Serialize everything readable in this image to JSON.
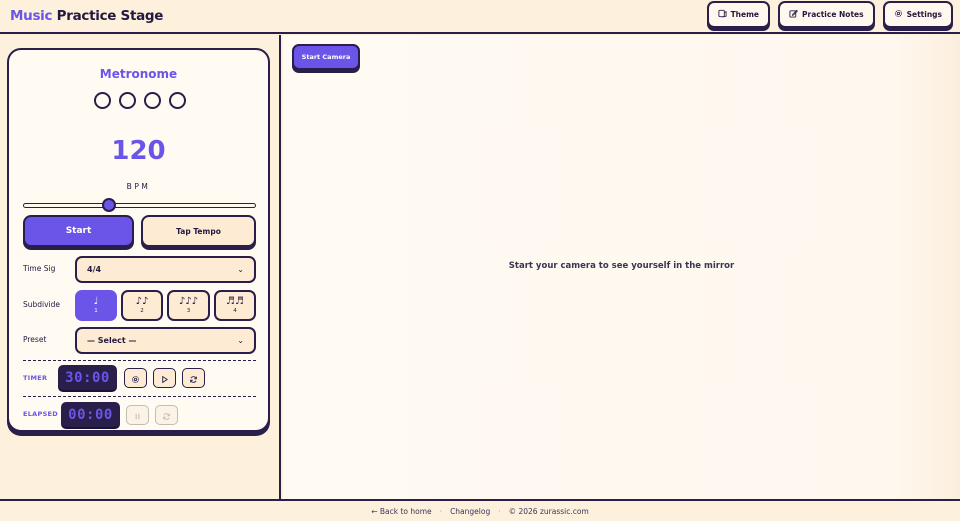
{
  "header": {
    "brand_accent": "Music",
    "brand_rest": "Practice Stage",
    "buttons": [
      {
        "label": "Theme",
        "icon": "palette-icon"
      },
      {
        "label": "Practice Notes",
        "icon": "edit-icon"
      },
      {
        "label": "Settings",
        "icon": "gear-icon"
      }
    ]
  },
  "metronome": {
    "title": "Metronome",
    "beats": 4,
    "bpm": "120",
    "bpm_label": "BPM",
    "tempo_fraction": 0.37,
    "start_label": "Start",
    "tap_label": "Tap Tempo",
    "time_sig_label": "Time Sig",
    "time_sig_value": "4/4",
    "subdivide_label": "Subdivide",
    "subdivisions": [
      {
        "glyph": "♩",
        "num": "1",
        "active": true
      },
      {
        "glyph": "♪♪",
        "num": "2",
        "active": false
      },
      {
        "glyph": "♪♪♪",
        "num": "3",
        "active": false
      },
      {
        "glyph": "♬♬",
        "num": "4",
        "active": false
      }
    ],
    "preset_label": "Preset",
    "preset_value": "— Select —"
  },
  "timer": {
    "label": "TIMER",
    "value": "30:00"
  },
  "elapsed": {
    "label": "ELAPSED",
    "value": "00:00"
  },
  "camera": {
    "start_label": "Start Camera",
    "message": "Start your camera to see yourself in the mirror"
  },
  "footer": {
    "back": "← Back to home",
    "changelog": "Changelog",
    "copyright": "© 2026 zurassic.com"
  },
  "colors": {
    "accent": "#6b55e8",
    "ink": "#2a1e4a",
    "background": "#fdf0dc"
  }
}
